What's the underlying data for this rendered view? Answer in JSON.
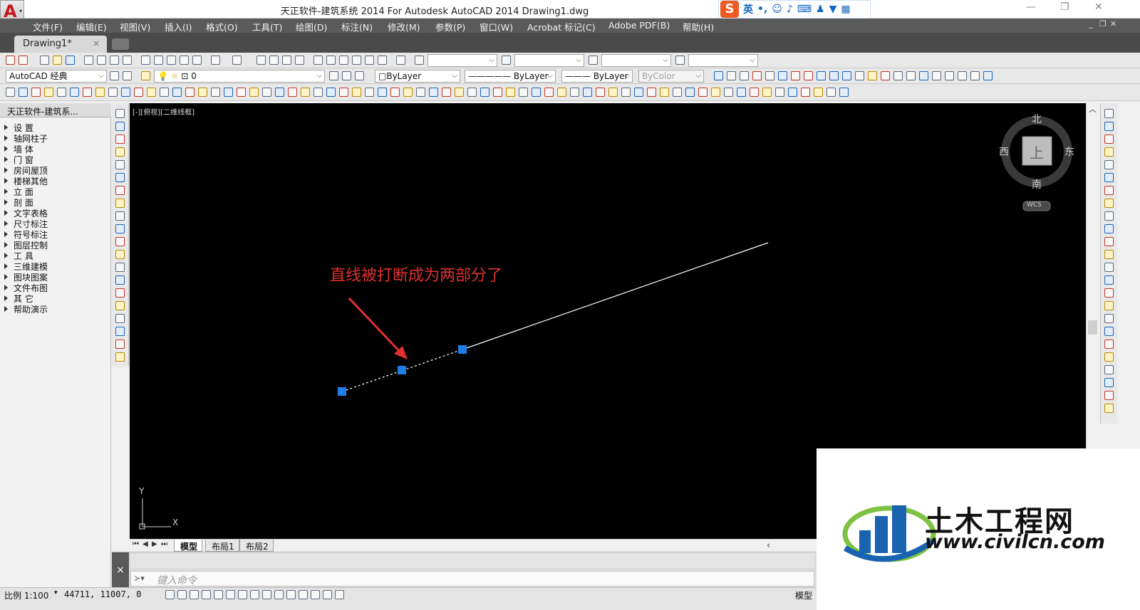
{
  "window": {
    "title": "天正软件-建筑系统 2014  For Autodesk AutoCAD 2014    Drawing1.dwg",
    "app_logo_letter": "A",
    "ime_mode": "英"
  },
  "menu": [
    "文件(F)",
    "编辑(E)",
    "视图(V)",
    "插入(I)",
    "格式(O)",
    "工具(T)",
    "绘图(D)",
    "标注(N)",
    "修改(M)",
    "参数(P)",
    "窗口(W)",
    "Acrobat 标记(C)",
    "Adobe PDF(B)",
    "帮助(H)"
  ],
  "document_tab": {
    "label": "Drawing1*",
    "close": "×"
  },
  "workspace": "AutoCAD 经典",
  "layer": "0",
  "properties": {
    "color": "ByLayer",
    "linetype": "ByLayer",
    "lineweight": "ByLayer",
    "plotstyle": "ByColor"
  },
  "palette": {
    "title": "天正软件-建筑系...",
    "items": [
      "设    置",
      "轴网柱子",
      "墙    体",
      "门    窗",
      "房间屋顶",
      "楼梯其他",
      "立    面",
      "剖    面",
      "文字表格",
      "尺寸标注",
      "符号标注",
      "图层控制",
      "工    具",
      "三维建模",
      "图块图案",
      "文件布图",
      "其    它",
      "帮助演示"
    ]
  },
  "viewport": {
    "label": "[-][俯视][二维线框]",
    "annotation": "直线被打断成为两部分了",
    "annotation_color": "#e03030",
    "grip_color": "#1e7fe8"
  },
  "viewcube": {
    "north": "北",
    "south": "南",
    "east": "东",
    "west": "西",
    "face": "上",
    "ucs": "WCS"
  },
  "ucs_axes": {
    "x": "X",
    "y": "Y"
  },
  "layout_tabs": [
    "模型",
    "布局1",
    "布局2"
  ],
  "command": {
    "close": "×",
    "prompt_icon": "≻▾",
    "placeholder": "键入命令"
  },
  "status": {
    "scale": "比例 1:100",
    "coordinates": "44711, 11007, 0",
    "model": "模型"
  },
  "watermark": {
    "title": "土木工程网",
    "url": "www.civilcn.com"
  }
}
